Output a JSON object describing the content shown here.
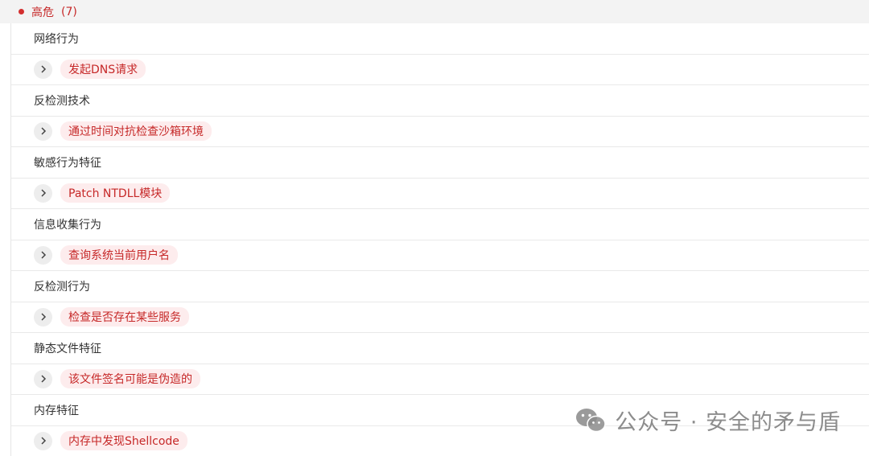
{
  "header": {
    "label": "高危",
    "count": "(7)",
    "dot_color": "#d32f2f"
  },
  "groups": [
    {
      "category": "网络行为",
      "item": "发起DNS请求"
    },
    {
      "category": "反检测技术",
      "item": "通过时间对抗检查沙箱环境"
    },
    {
      "category": "敏感行为特征",
      "item": "Patch NTDLL模块"
    },
    {
      "category": "信息收集行为",
      "item": "查询系统当前用户名"
    },
    {
      "category": "反检测行为",
      "item": "检查是否存在某些服务"
    },
    {
      "category": "静态文件特征",
      "item": "该文件签名可能是伪造的"
    },
    {
      "category": "内存特征",
      "item": "内存中发现Shellcode"
    }
  ],
  "expand_icon": "chevron-right-icon",
  "watermark": {
    "icon": "wechat-icon",
    "text": "公众号 · 安全的矛与盾"
  },
  "colors": {
    "accent": "#c62828",
    "tag_bg": "#fdeced"
  }
}
